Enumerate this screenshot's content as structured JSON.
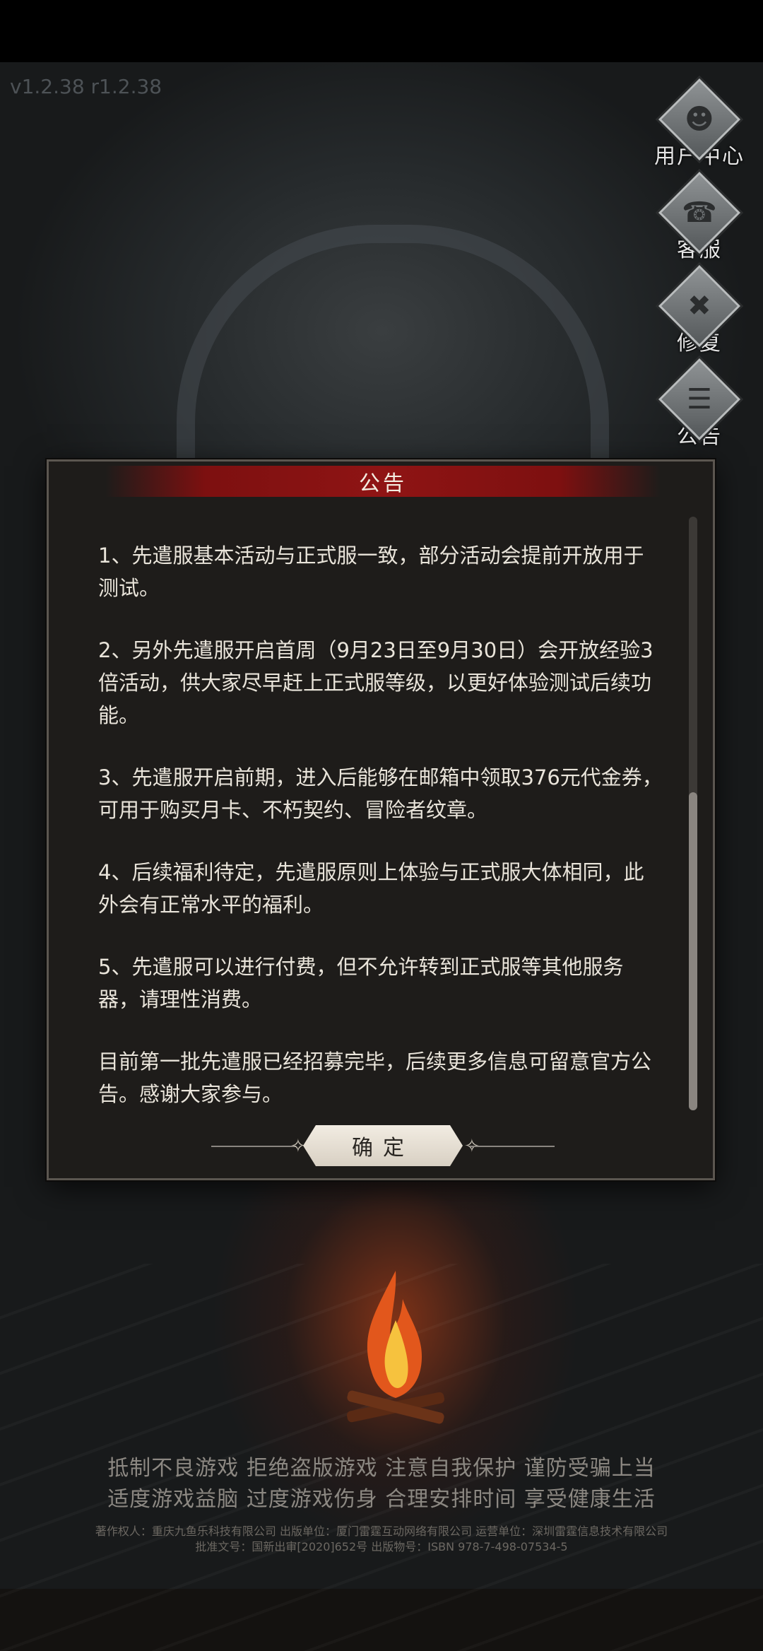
{
  "version": "v1.2.38 r1.2.38",
  "side_menu": [
    {
      "label": "用户中心",
      "icon": "user-icon"
    },
    {
      "label": "客服",
      "icon": "customer-service-icon"
    },
    {
      "label": "修复",
      "icon": "repair-tools-icon"
    },
    {
      "label": "公告",
      "icon": "announcement-icon"
    }
  ],
  "dialog": {
    "title": "公告",
    "paragraphs": [
      "1、先遣服基本活动与正式服一致，部分活动会提前开放用于测试。",
      "2、另外先遣服开启首周（9月23日至9月30日）会开放经验3倍活动，供大家尽早赶上正式服等级，以更好体验测试后续功能。",
      "3、先遣服开启前期，进入后能够在邮箱中领取376元代金券，可用于购买月卡、不朽契约、冒险者纹章。",
      "4、后续福利待定，先遣服原则上体验与正式服大体相同，此外会有正常水平的福利。",
      "5、先遣服可以进行付费，但不允许转到正式服等其他服务器，请理性消费。",
      "目前第一批先遣服已经招募完毕，后续更多信息可留意官方公告。感谢大家参与。"
    ],
    "confirm_label": "确定"
  },
  "health_notice": [
    "抵制不良游戏 拒绝盗版游戏 注意自我保护 谨防受骗上当",
    "适度游戏益脑 过度游戏伤身 合理安排时间 享受健康生活"
  ],
  "copyright": [
    "著作权人：重庆九鱼乐科技有限公司 出版单位：厦门雷霆互动网络有限公司 运营单位：深圳雷霆信息技术有限公司",
    "批准文号：国新出审[2020]652号 出版物号：ISBN 978-7-498-07534-5"
  ]
}
